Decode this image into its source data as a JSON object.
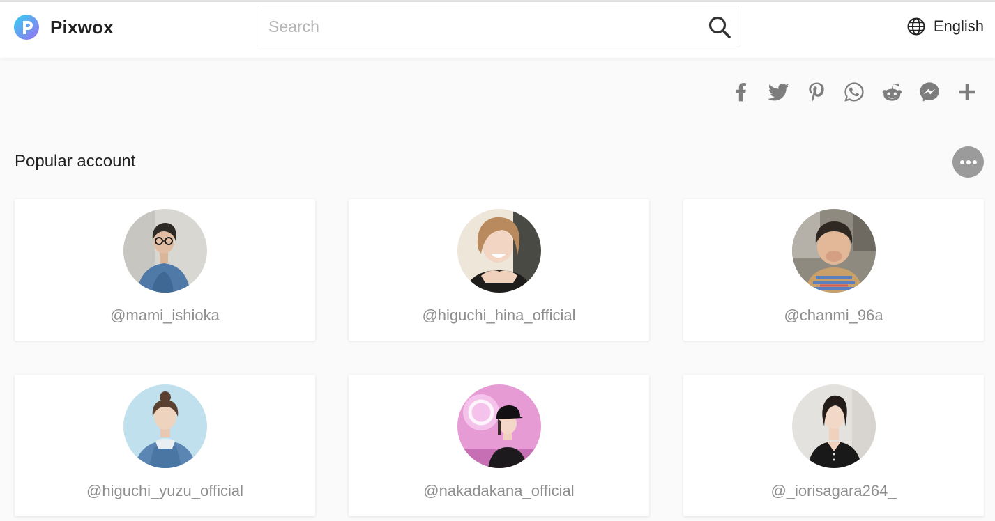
{
  "brand": {
    "name": "Pixwox"
  },
  "search": {
    "placeholder": "Search"
  },
  "language": {
    "label": "English"
  },
  "share_icons": [
    "facebook-icon",
    "twitter-icon",
    "pinterest-icon",
    "whatsapp-icon",
    "reddit-icon",
    "messenger-icon",
    "plus-icon"
  ],
  "section": {
    "title": "Popular account"
  },
  "accounts": [
    {
      "handle": "@mami_ishioka"
    },
    {
      "handle": "@higuchi_hina_official"
    },
    {
      "handle": "@chanmi_96a"
    },
    {
      "handle": "@higuchi_yuzu_official"
    },
    {
      "handle": "@nakadakana_official"
    },
    {
      "handle": "@_iorisagara264_"
    }
  ],
  "colors": {
    "icon_gray": "#7d7d7d",
    "more_button": "#9b9b9b",
    "handle_text": "#8e8e8e",
    "logo_gradient_start": "#38c8f0",
    "logo_gradient_end": "#8c7cf2"
  }
}
